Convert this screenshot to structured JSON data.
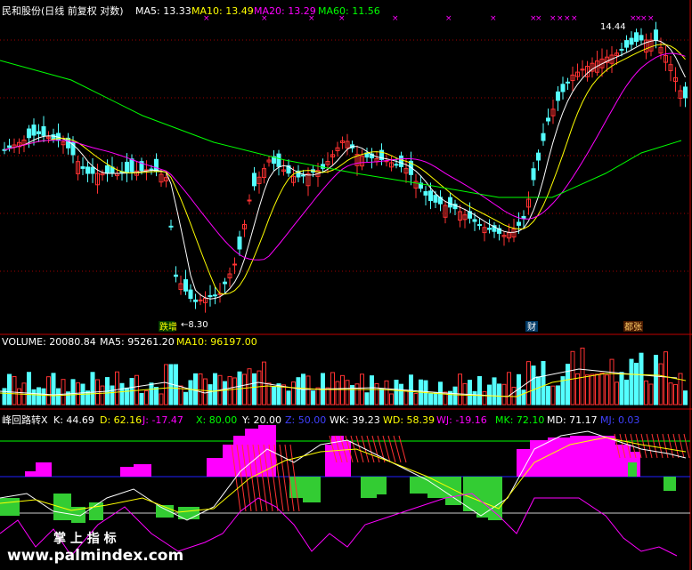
{
  "price_panel": {
    "header": {
      "title": "民和股份(日线 前复权 对数)",
      "ma5": "MA5: 13.33",
      "ma10": "MA10: 13.49",
      "ma20": "MA20: 13.29",
      "ma60": "MA60: 11.56"
    },
    "high_label": "14.44",
    "low_label": "←8.30",
    "tags": [
      "跌增",
      "财",
      "都张"
    ]
  },
  "volume_panel": {
    "header": {
      "volume": "VOLUME: 20080.84",
      "ma5": "MA5: 95261.20",
      "ma10": "MA10: 96197.00"
    }
  },
  "indicator_panel": {
    "header": {
      "name": "峰回路转X",
      "k": "K: 44.69",
      "d": "D: 62.16",
      "j": "J: -17.47",
      "x": "X: 80.00",
      "y": "Y: 20.00",
      "z": "Z: 50.00",
      "wk": "WK: 39.23",
      "wd": "WD: 58.39",
      "wj": "WJ: -19.16",
      "mk": "MK: 72.10",
      "md": "MD: 71.17",
      "mj": "MJ: 0.03"
    }
  },
  "watermark": {
    "line1": "掌 上 指 标",
    "line2": "www.palmindex.com"
  },
  "colors": {
    "up": "#ff3232",
    "down": "#54ffff",
    "ma5": "#ffffff",
    "ma10": "#ffff00",
    "ma20": "#ff00ff",
    "ma60": "#00ff00",
    "grid": "#a00000",
    "magenta_bar": "#ff00ff",
    "green_bar": "#33cc33",
    "blue_line": "#2020ff"
  }
}
